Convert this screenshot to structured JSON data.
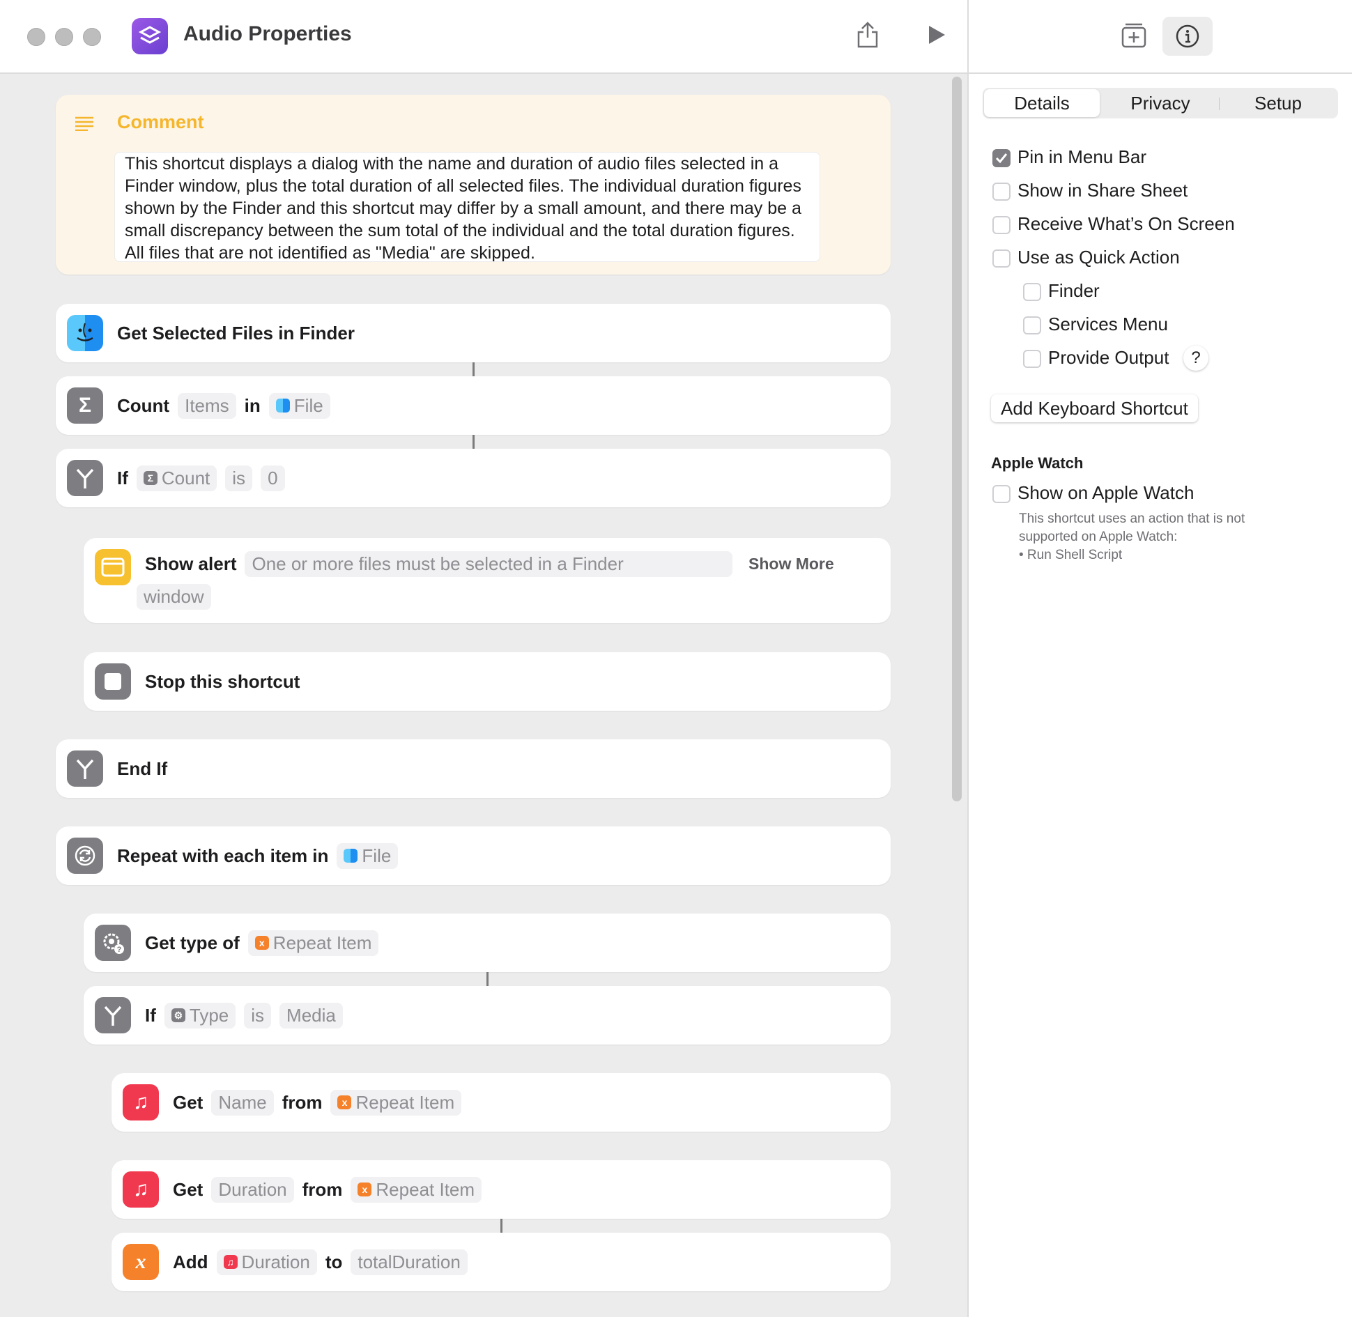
{
  "window": {
    "title": "Audio Properties"
  },
  "comment": {
    "title": "Comment",
    "text": "This shortcut displays a dialog with the name and duration of audio files selected in a Finder window, plus the total duration of all selected files. The individual duration figures shown by the Finder and this shortcut may differ by a small amount, and there may be a small discrepancy between the sum total of the individual and the total duration figures. All files that are not identified as \"Media\" are skipped."
  },
  "actions": {
    "get_selected": {
      "label": "Get Selected Files in Finder"
    },
    "count": {
      "kw": "Count",
      "what": "Items",
      "in": "in",
      "var": "File"
    },
    "if1": {
      "kw": "If",
      "var": "Count",
      "op": "is",
      "value": "0"
    },
    "alert": {
      "kw": "Show alert",
      "msg1": "One or more files must be selected in a Finder",
      "msg2": "window",
      "more": "Show More"
    },
    "stop": {
      "label": "Stop this shortcut"
    },
    "endif": {
      "label": "End If"
    },
    "repeat": {
      "kw": "Repeat with each item in",
      "var": "File"
    },
    "gettype": {
      "kw": "Get type of",
      "var": "Repeat Item"
    },
    "if2": {
      "kw": "If",
      "var": "Type",
      "op": "is",
      "value": "Media"
    },
    "getname": {
      "kw": "Get",
      "prop": "Name",
      "from": "from",
      "var": "Repeat Item"
    },
    "getdur": {
      "kw": "Get",
      "prop": "Duration",
      "from": "from",
      "var": "Repeat Item"
    },
    "add": {
      "kw": "Add",
      "var": "Duration",
      "to": "to",
      "target": "totalDuration"
    }
  },
  "sidebar": {
    "tabs": [
      "Details",
      "Privacy",
      "Setup"
    ],
    "options": {
      "pin_menu_bar": {
        "label": "Pin in Menu Bar",
        "checked": true
      },
      "share_sheet": {
        "label": "Show in Share Sheet",
        "checked": false
      },
      "whats_on_screen": {
        "label": "Receive What’s On Screen",
        "checked": false
      },
      "quick_action": {
        "label": "Use as Quick Action",
        "checked": false
      },
      "finder": {
        "label": "Finder",
        "checked": false
      },
      "services_menu": {
        "label": "Services Menu",
        "checked": false
      },
      "provide_output": {
        "label": "Provide Output",
        "checked": false
      },
      "help": "?"
    },
    "keyboard_button": "Add Keyboard Shortcut",
    "apple_watch": {
      "heading": "Apple Watch",
      "option": "Show on Apple Watch",
      "note1": "This shortcut uses an action that is not",
      "note2": "supported on Apple Watch:",
      "note3": "• Run Shell Script"
    }
  },
  "colors": {
    "comment_bg": "#fcf5e8",
    "comment_title": "#f5b62c",
    "alert_icon": "#f7c02e",
    "music_icon": "#f0384f",
    "variable_icon": "#f5812a",
    "gray_icon": "#7d7d82"
  },
  "icons": {
    "app": "shortcuts-icon",
    "share": "share-icon",
    "run": "play-icon",
    "library": "add-to-library-icon",
    "info": "info-icon"
  }
}
